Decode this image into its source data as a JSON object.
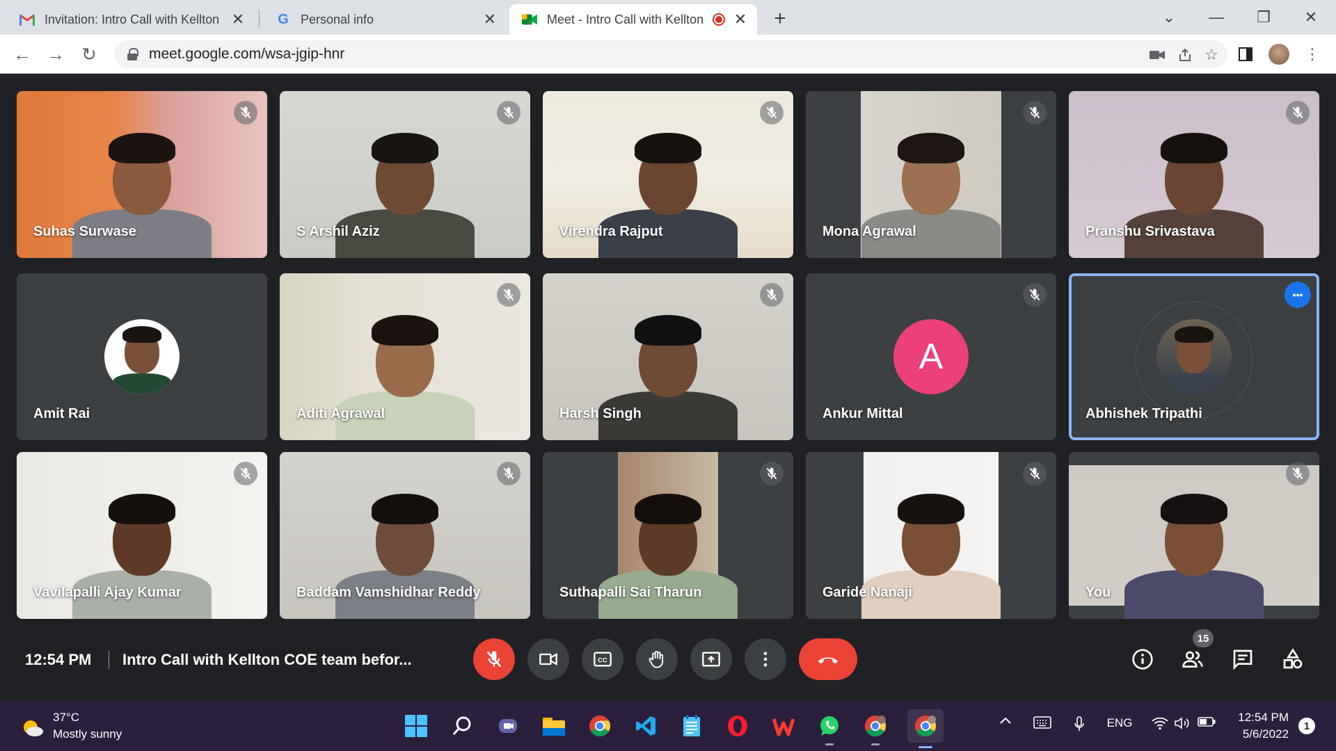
{
  "browser": {
    "tabs": [
      {
        "title": "Invitation: Intro Call with Kellton C",
        "favicon": "gmail-icon"
      },
      {
        "title": "Personal info",
        "favicon": "google-icon"
      },
      {
        "title": "Meet - Intro Call with Kellton",
        "favicon": "meet-icon",
        "recording": true
      }
    ],
    "url": "meet.google.com/wsa-jgip-hnr"
  },
  "meet": {
    "participants": [
      {
        "name": "Suhas Surwase",
        "muted": true,
        "video": true
      },
      {
        "name": "S Arshil Aziz",
        "muted": true,
        "video": true
      },
      {
        "name": "Virendra Rajput",
        "muted": true,
        "video": true
      },
      {
        "name": "Mona Agrawal",
        "muted": true,
        "video": true
      },
      {
        "name": "Pranshu Srivastava",
        "muted": true,
        "video": true
      },
      {
        "name": "Amit Rai",
        "muted": false,
        "video": false
      },
      {
        "name": "Aditi Agrawal",
        "muted": true,
        "video": true
      },
      {
        "name": "Harsh Singh",
        "muted": true,
        "video": true
      },
      {
        "name": "Ankur Mittal",
        "muted": true,
        "video": false,
        "avatar_letter": "A"
      },
      {
        "name": "Abhishek Tripathi",
        "muted": false,
        "video": false,
        "active": true
      },
      {
        "name": "Vavilapalli Ajay Kumar",
        "muted": true,
        "video": true
      },
      {
        "name": "Baddam Vamshidhar Reddy",
        "muted": true,
        "video": true
      },
      {
        "name": "Suthapalli Sai Tharun",
        "muted": true,
        "video": true
      },
      {
        "name": "Garide Nanaji",
        "muted": true,
        "video": true
      },
      {
        "name": "You",
        "muted": true,
        "video": true
      }
    ],
    "time": "12:54 PM",
    "meeting_title": "Intro Call with Kellton COE team befor...",
    "participant_count": "15",
    "accent": "#ea4335"
  },
  "taskbar": {
    "weather_temp": "37°C",
    "weather_desc": "Mostly sunny",
    "language": "ENG",
    "time": "12:54 PM",
    "date": "5/6/2022",
    "notification_count": "1"
  }
}
